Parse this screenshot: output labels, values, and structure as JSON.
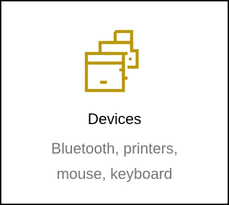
{
  "tile": {
    "title": "Devices",
    "description_lines": [
      "Bluetooth, printers,",
      "mouse, keyboard"
    ],
    "icon": "devices-printer-icon",
    "accent_color": "#B8980C",
    "description_color": "#767676"
  }
}
